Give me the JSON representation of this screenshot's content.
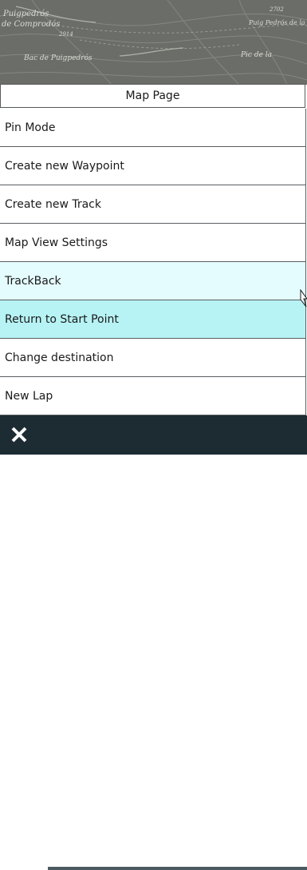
{
  "map": {
    "labels": [
      "Puigpedrós",
      "de Comprodós",
      "Puig Pedrós de la Tosa",
      "Bac de Puigpedrós",
      "Pic de la",
      "2914",
      "2702"
    ]
  },
  "menu": {
    "title": "Map Page",
    "items": [
      {
        "label": "Pin Mode",
        "state": "normal"
      },
      {
        "label": "Create new Waypoint",
        "state": "normal"
      },
      {
        "label": "Create new Track",
        "state": "normal"
      },
      {
        "label": "Map View Settings",
        "state": "normal"
      },
      {
        "label": "TrackBack",
        "state": "hover"
      },
      {
        "label": "Return to Start Point",
        "state": "selected"
      },
      {
        "label": "Change destination",
        "state": "normal"
      },
      {
        "label": "New Lap",
        "state": "normal"
      }
    ]
  },
  "footer": {
    "close_icon": "close-icon"
  },
  "colors": {
    "hover": "#e4fcfd",
    "selected": "#b7f3f5",
    "footer": "#1d2b33"
  }
}
